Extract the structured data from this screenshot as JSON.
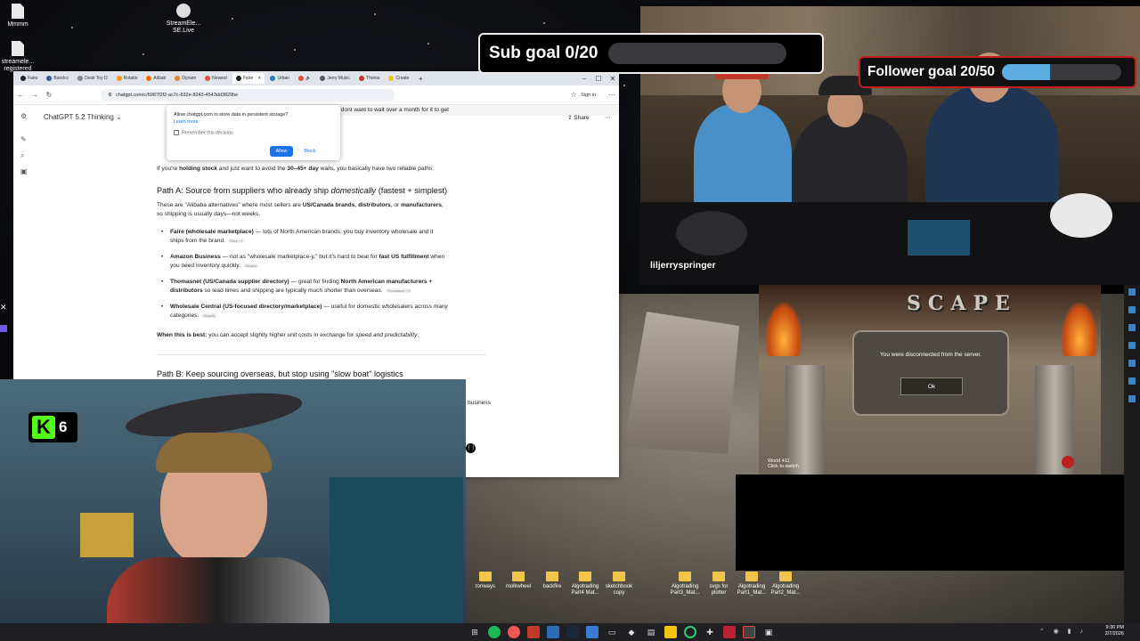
{
  "desktop_top_icons": [
    {
      "label": "Mmmm",
      "type": "doc"
    },
    {
      "label": "StreamEle... SE.Live",
      "type": "app"
    },
    {
      "label": "streamele... registered",
      "type": "doc"
    }
  ],
  "desktop_icons": [
    {
      "label": "tonways"
    },
    {
      "label": "molkwheel"
    },
    {
      "label": "backfire"
    },
    {
      "label": "Algotrading Part4 Mat..."
    },
    {
      "label": "sketchbook copy"
    },
    {
      "label": "Algotrading Part3_Mat..."
    },
    {
      "label": "svgs for plotter"
    },
    {
      "label": "Algotrading Part1_Mat..."
    },
    {
      "label": "Algotrading Part2_Mat..."
    }
  ],
  "browser": {
    "tabs": [
      {
        "label": "Faire",
        "color": "#222"
      },
      {
        "label": "Bandcc",
        "color": "#3b5998"
      },
      {
        "label": "Desk Toy D",
        "color": "#888"
      },
      {
        "label": "Rotatin",
        "color": "#f39c12"
      },
      {
        "label": "Alibab",
        "color": "#ff6a00"
      },
      {
        "label": "Dynam",
        "color": "#e67e22"
      },
      {
        "label": "Newest",
        "color": "#e74c3c"
      },
      {
        "label": "Faire",
        "color": "#222",
        "active": true
      },
      {
        "label": "Urban",
        "color": "#2980b9"
      },
      {
        "label": "",
        "color": "#e74c3c"
      },
      {
        "label": "Jerry Music",
        "color": "#555"
      },
      {
        "label": "Thoma",
        "color": "#c0392b"
      },
      {
        "label": "Create",
        "color": "#f1c40f"
      }
    ],
    "url": "chatgpt.com/c/6987f2f2-ac7c-832e-8243-4543dd3829be",
    "signin": "Sign in",
    "model": "ChatGPT 5.2 Thinking",
    "share_label": "Share",
    "prompt_snippet": "just dont want to wait over a month for it to get",
    "permission": {
      "title": "Allow chatgpt.com to store data in persistent storage?",
      "learn_more": "Learn more",
      "remember": "Remember this decision",
      "allow": "Allow",
      "block": "Block"
    },
    "intro_pre": "If you're ",
    "intro_b1": "holding stock",
    "intro_mid": " and just want to avoid the ",
    "intro_b2": "30–45+ day",
    "intro_post": " waits, you basically have two reliable paths:",
    "pathA_title_pre": "Path A: Source from suppliers who already ship ",
    "pathA_title_em": "domestically",
    "pathA_title_post": " (fastest + simplest)",
    "pathA_desc_1": "These are \"Alibaba alternatives\" where most sellers are ",
    "pathA_desc_b": "US/Canada brands",
    "pathA_desc_2": ", ",
    "pathA_desc_b2": "distributors",
    "pathA_desc_3": ", or ",
    "pathA_desc_b3": "manufacturers",
    "pathA_desc_4": ",",
    "pathA_desc_line2": "so shipping is usually days—not weeks.",
    "bullets": [
      {
        "b": "Faire (wholesale marketplace)",
        "t": " — lots of North American brands; you buy inventory wholesale and it",
        "t2": "ships from the brand.",
        "src": "Faire +1"
      },
      {
        "b": "Amazon Business",
        "t": " — not as \"wholesale marketplace-y,\" but it's hard to beat for ",
        "b2": "fast US fulfillment",
        "t3": " when",
        "t2": "you need inventory quickly.",
        "src": "Shopify"
      },
      {
        "b": "Thomasnet (US/Canada supplier directory)",
        "t": " — great for finding ",
        "b2": "North American manufacturers +",
        "t2": "distributors",
        "t4": " so lead times and shipping are typically much shorter than overseas.",
        "src": "Thomasnet +1"
      },
      {
        "b": "Wholesale Central (US-focused directory/marketplace)",
        "t": " — useful for domestic wholesalers across many",
        "t2": "categories.",
        "src": "Shopify"
      }
    ],
    "when_b": "When this is best:",
    "when_t": " you can accept slightly higher unit costs in exchange for ",
    "when_em": "speed and predictability",
    "when_end": ".",
    "pathB_title": "Path B: Keep sourcing overseas, but stop using \"slow boat\" logistics",
    "pathB_fragment": "business"
  },
  "overlays": {
    "sub_goal": "Sub goal 0/20",
    "sub_progress": 0.0,
    "follower_goal": "Follower goal 20/50",
    "follower_progress": 0.4,
    "dj_name": "liljerryspringer",
    "kick_count": "6",
    "kick_letter": "K"
  },
  "game": {
    "logo": "SCAPE",
    "message": "You were disconnected from the server.",
    "ok": "Ok",
    "world": "World 411",
    "world_sub": "Click to switch"
  },
  "taskbar": {
    "time": "9:30 PM",
    "date": "2/7/2026"
  }
}
